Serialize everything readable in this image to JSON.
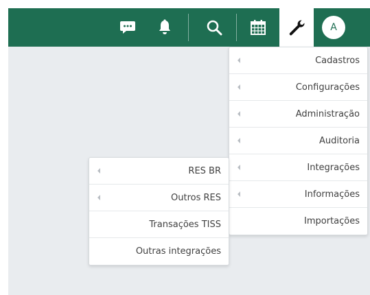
{
  "topbar": {
    "bg_color": "#1e6e52",
    "icons": [
      "chat-icon",
      "bell-icon",
      "search-icon",
      "calendar-icon",
      "wrench-icon"
    ],
    "avatar_initial": "A"
  },
  "main_menu": {
    "items": [
      {
        "label": "Cadastros",
        "submenu": true
      },
      {
        "label": "Configurações",
        "submenu": true
      },
      {
        "label": "Administração",
        "submenu": true
      },
      {
        "label": "Auditoria",
        "submenu": true
      },
      {
        "label": "Integrações",
        "submenu": true
      },
      {
        "label": "Informações",
        "submenu": true
      },
      {
        "label": "Importações",
        "submenu": false
      }
    ]
  },
  "integrations_submenu": {
    "items": [
      {
        "label": "RES BR",
        "submenu": true
      },
      {
        "label": "Outros RES",
        "submenu": true
      },
      {
        "label": "Transações TISS",
        "submenu": false
      },
      {
        "label": "Outras integrações",
        "submenu": false
      }
    ]
  }
}
